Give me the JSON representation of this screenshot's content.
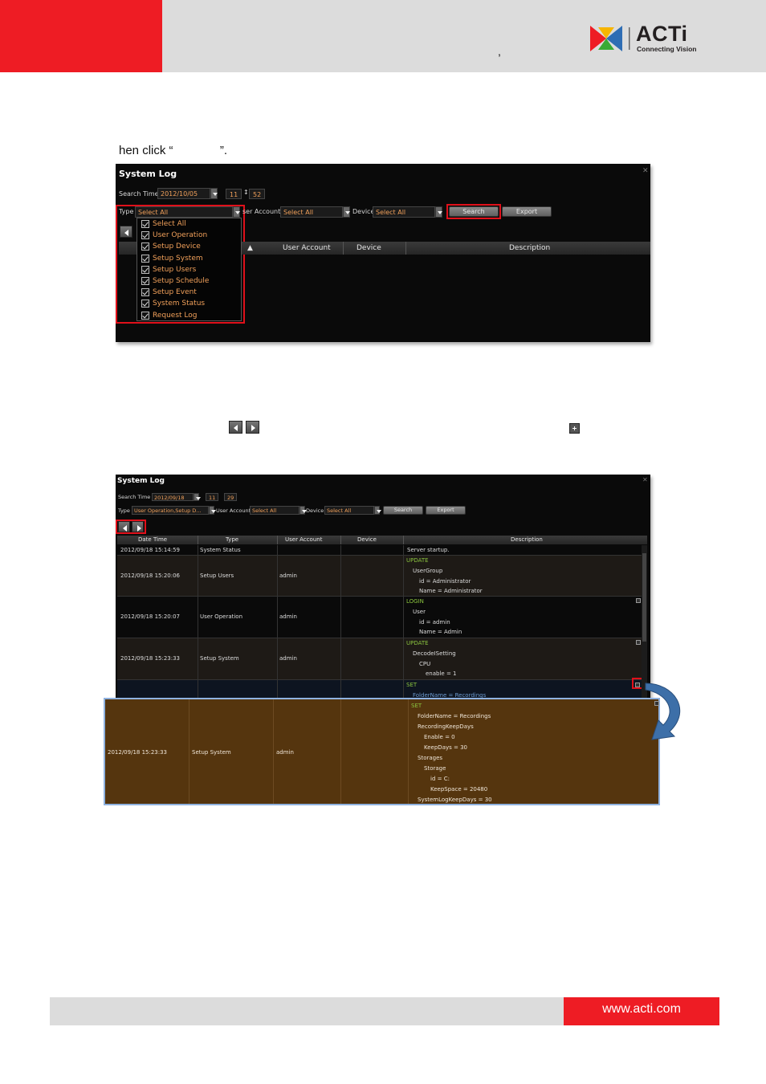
{
  "header": {
    "comma": ",",
    "logo": {
      "brand": "ACTi",
      "tagline": "Connecting Vision"
    }
  },
  "intro_text": "hen click “              ”.",
  "shot1": {
    "title": "System Log",
    "search_time_label": "Search Time",
    "date": "2012/10/05",
    "hour": "11",
    "minute": "52",
    "type_label": "Type",
    "type_value": "Select All",
    "user_account_label": "ser Account",
    "user_account_value": "Select All",
    "device_label": "Device",
    "device_value": "Select All",
    "search_button": "Search",
    "export_button": "Export",
    "type_options": [
      "Select All",
      "User Operation",
      "Setup Device",
      "Setup System",
      "Setup Users",
      "Setup Schedule",
      "Setup Event",
      "System Status",
      "Request Log"
    ],
    "columns": {
      "partial": "I",
      "user_account": "User Account",
      "device": "Device",
      "description": "Description"
    }
  },
  "shot2": {
    "title": "System Log",
    "search_time_label": "Search Time",
    "date": "2012/09/18",
    "hour": "11",
    "minute": "29",
    "type_label": "Type",
    "type_value": "User Operation,Setup D...",
    "user_account_label": "User Account",
    "user_account_value": "Select All",
    "device_label": "Device",
    "device_value": "Select All",
    "search_button": "Search",
    "export_button": "Export",
    "columns": [
      "Date Time",
      "Type",
      "User Account",
      "Device",
      "Description"
    ],
    "rows": [
      {
        "datetime": "2012/09/18 15:14:59",
        "type": "System Status",
        "user": "",
        "desc": [
          "Server startup."
        ]
      },
      {
        "datetime": "2012/09/18 15:20:06",
        "type": "Setup Users",
        "user": "admin",
        "desc": [
          "UPDATE",
          "UserGroup",
          "id = Administrator",
          "Name = Administrator"
        ]
      },
      {
        "datetime": "2012/09/18 15:20:07",
        "type": "User Operation",
        "user": "admin",
        "desc": [
          "LOGIN",
          "User",
          "id = admin",
          "Name = Admin"
        ]
      },
      {
        "datetime": "2012/09/18 15:23:33",
        "type": "Setup System",
        "user": "admin",
        "desc": [
          "UPDATE",
          "DecodeISetting",
          "CPU",
          "enable = 1"
        ]
      },
      {
        "datetime": "",
        "type": "",
        "user": "",
        "desc": [
          "SET",
          "FolderName = Recordings"
        ]
      }
    ]
  },
  "expanded_row": {
    "datetime": "2012/09/18 15:23:33",
    "type": "Setup System",
    "user": "admin",
    "desc": [
      "SET",
      "FolderName = Recordings",
      "RecordingKeepDays",
      "Enable = 0",
      "KeepDays = 30",
      "Storages",
      "Storage",
      "id = C:",
      "KeepSpace = 20480",
      "SystemLogKeepDays = 30"
    ]
  },
  "footer": {
    "url": "www.acti.com"
  },
  "colors": {
    "brand_red": "#ee1c24",
    "field_text": "#f1a05a",
    "keyword_green": "#8bc53f",
    "expanded_bg": "#55350e"
  }
}
